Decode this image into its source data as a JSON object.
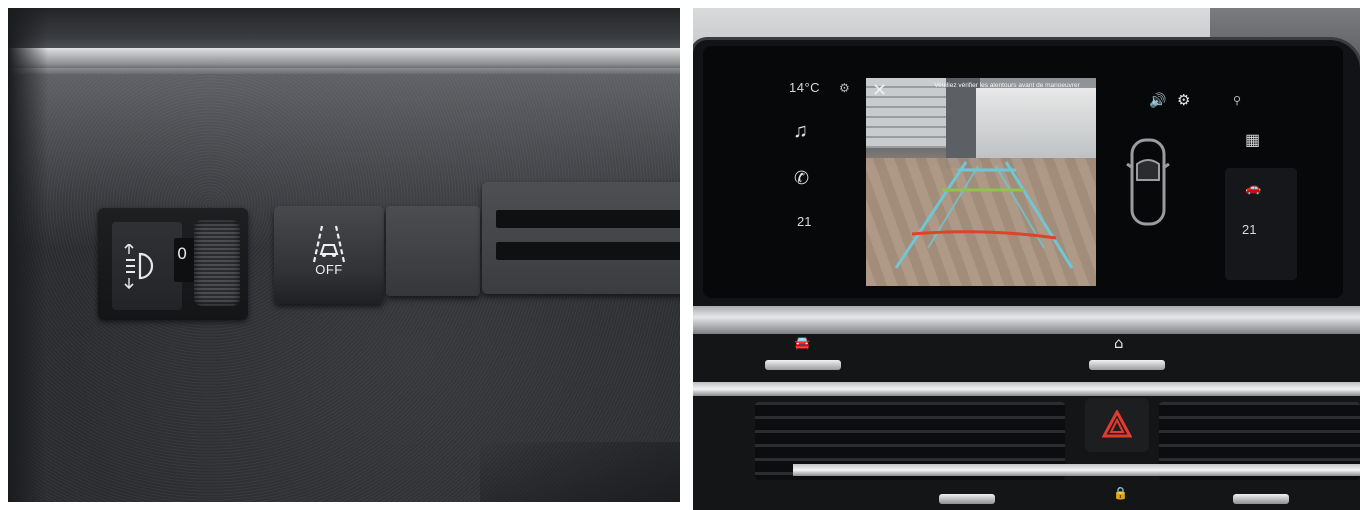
{
  "left_photo": {
    "headlamp_wheel_value": "0",
    "lane_button_label": "OFF",
    "icons": [
      "headlamp-level-icon",
      "lane-assist-icon"
    ]
  },
  "right_photo": {
    "status": {
      "temperature": "14°C",
      "left_climate_temp": "21",
      "right_climate_temp": "21"
    },
    "camera": {
      "message": "Veuillez vérifier les alentours avant de manoeuvrer",
      "close_label": "✕"
    },
    "icons": [
      "music-icon",
      "phone-icon",
      "speaker-icon",
      "settings-icon",
      "car-top-view-icon",
      "location-icon",
      "apps-grid-icon",
      "car-icon",
      "car-shortcut-icon",
      "home-icon",
      "hazard-icon",
      "lock-icon"
    ],
    "colors": {
      "guide_near": "#e0422a",
      "guide_mid": "#8fc34a",
      "guide_far": "#6fc6d4"
    }
  }
}
